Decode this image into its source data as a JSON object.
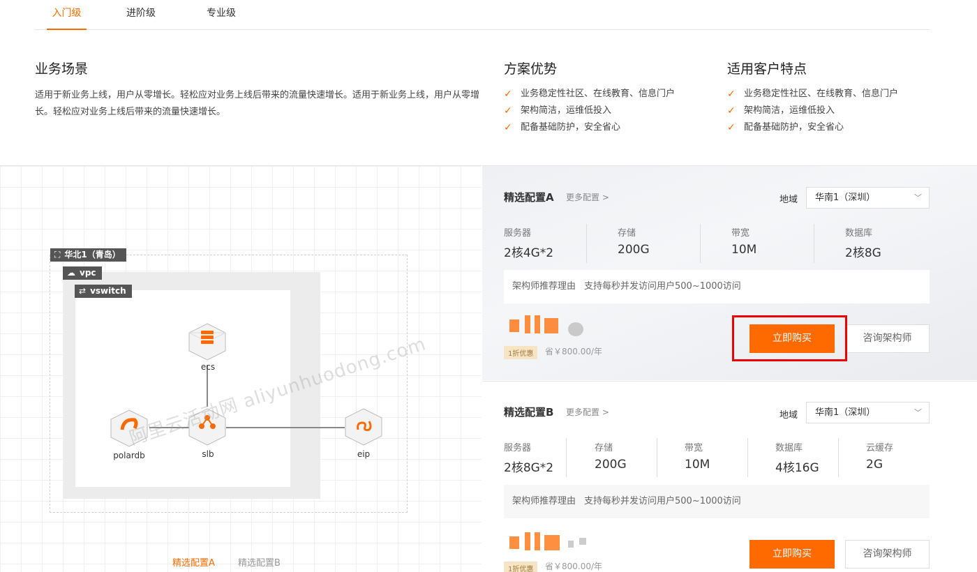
{
  "tabs": [
    "入门级",
    "进阶级",
    "专业级"
  ],
  "scene": {
    "title": "业务场景",
    "text": "适用于新业务上线，用户从零增长。轻松应对业务上线后带来的流量快速增长。适用于新业务上线，用户从零增长。轻松应对业务上线后带来的流量快速增长。"
  },
  "advantages": {
    "title": "方案优势",
    "items": [
      "业务稳定性社区、在线教育、信息门户",
      "架构简洁，运维低投入",
      "配备基础防护，安全省心"
    ]
  },
  "customers": {
    "title": "适用客户特点",
    "items": [
      "业务稳定性社区、在线教育、信息门户",
      "架构简洁，运维低投入",
      "配备基础防护，安全省心"
    ]
  },
  "diagram": {
    "region_tag": "华北1（青岛）",
    "vpc_tag": "vpc",
    "vswitch_tag": "vswitch",
    "nodes": {
      "ecs": "ecs",
      "slb": "slb",
      "polardb": "polardb",
      "eip": "eip"
    },
    "watermark": "阿里云活动网 aliyunhuodong.com",
    "tabs": [
      "精选配置A",
      "精选配置B"
    ]
  },
  "colors": {
    "accent": "#ff6a00",
    "highlight": "#e00000"
  },
  "configA": {
    "title": "精选配置A",
    "more": "更多配置 >",
    "region_label": "地域",
    "region_value": "华南1（深圳）",
    "specs": [
      {
        "k": "服务器",
        "v": "2核4G*2"
      },
      {
        "k": "存储",
        "v": "200G"
      },
      {
        "k": "带宽",
        "v": "10M"
      },
      {
        "k": "数据库",
        "v": "2核8G"
      }
    ],
    "reason_label": "架构师推荐理由",
    "reason_value": "支持每秒并发访问用户500~1000访问",
    "discount": "1折优惠",
    "save": "省￥800.00/年",
    "buy": "立即购买",
    "consult": "咨询架构师"
  },
  "configB": {
    "title": "精选配置B",
    "more": "更多配置 >",
    "region_label": "地域",
    "region_value": "华南1（深圳）",
    "specs": [
      {
        "k": "服务器",
        "v": "2核8G*2"
      },
      {
        "k": "存储",
        "v": "200G"
      },
      {
        "k": "带宽",
        "v": "10M"
      },
      {
        "k": "数据库",
        "v": "4核16G"
      },
      {
        "k": "云缓存",
        "v": "2G"
      }
    ],
    "reason_label": "架构师推荐理由",
    "reason_value": "支持每秒并发访问用户500~1000访问",
    "discount": "1折优惠",
    "save": "省￥800.00/年",
    "buy": "立即购买",
    "consult": "咨询架构师"
  }
}
